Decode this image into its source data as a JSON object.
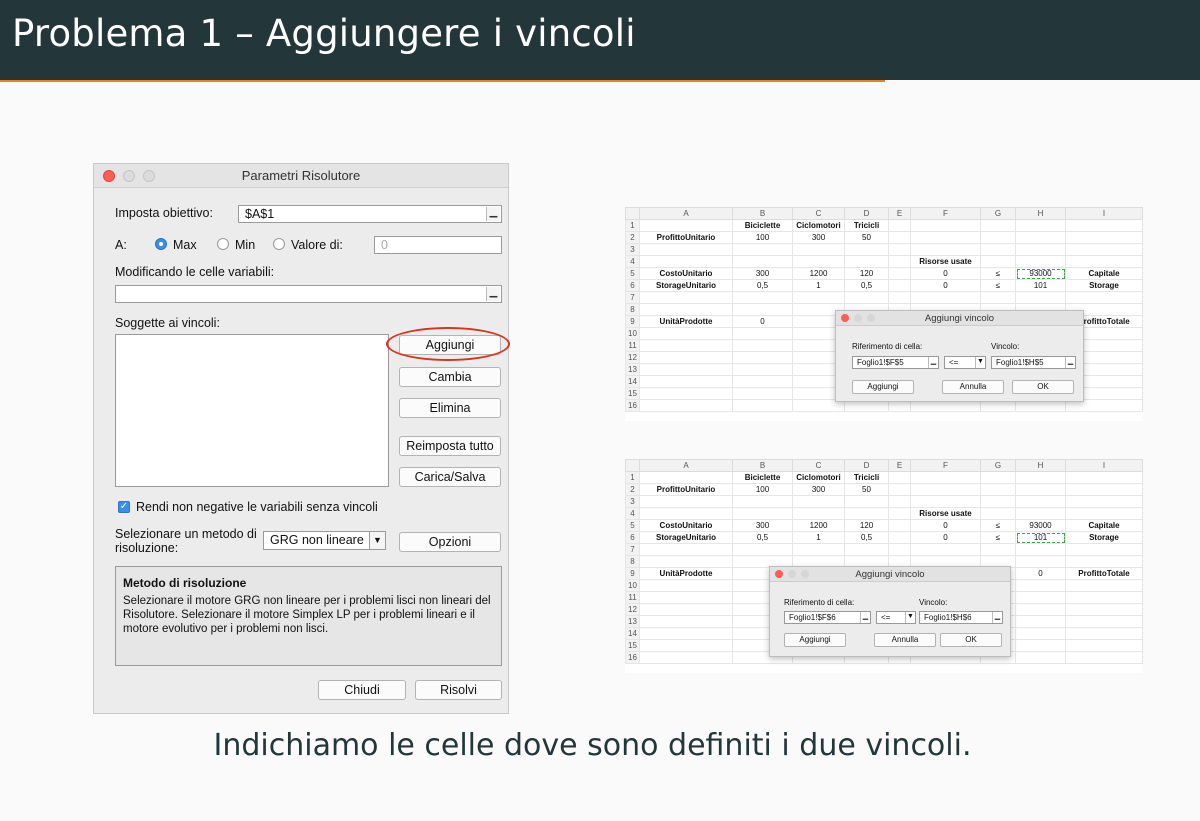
{
  "slide": {
    "title": "Problema 1 – Aggiungere i vincoli",
    "caption": "Indichiamo le celle dove sono definiti i due vincoli."
  },
  "solver": {
    "window_title": "Parametri Risolutore",
    "objective_label": "Imposta obiettivo:",
    "objective_value": "$A$1",
    "to_label": "A:",
    "opt_max": "Max",
    "opt_min": "Min",
    "opt_value": "Valore di:",
    "value_field": "0",
    "selected_option": "Max",
    "changing_label": "Modificando le celle variabili:",
    "changing_value": "",
    "constraints_label": "Soggette ai vincoli:",
    "buttons": {
      "add": "Aggiungi",
      "change": "Cambia",
      "delete": "Elimina",
      "reset": "Reimposta tutto",
      "load_save": "Carica/Salva",
      "options": "Opzioni",
      "close": "Chiudi",
      "solve": "Risolvi"
    },
    "nonneg_label": "Rendi non negative le variabili senza vincoli",
    "nonneg_checked": true,
    "method_label_1": "Selezionare un metodo di",
    "method_label_2": "risoluzione:",
    "method_value": "GRG non lineare",
    "method_box_title": "Metodo di risoluzione",
    "method_box_text": "Selezionare il motore GRG non lineare per i problemi lisci non lineari del Risolutore. Selezionare il motore Simplex LP per i problemi lineari e il motore evolutivo per i problemi non lisci."
  },
  "sheets": {
    "columns": [
      "",
      "A",
      "B",
      "C",
      "D",
      "E",
      "F",
      "G",
      "H",
      "I"
    ],
    "top": {
      "rows": [
        [
          "1",
          "",
          "Biciclette",
          "Ciclomotori",
          "Tricicli",
          "",
          "",
          "",
          "",
          ""
        ],
        [
          "2",
          "ProfittoUnitario",
          "100",
          "300",
          "50",
          "",
          "",
          "",
          "",
          ""
        ],
        [
          "3",
          "",
          "",
          "",
          "",
          "",
          "",
          "",
          "",
          ""
        ],
        [
          "4",
          "",
          "",
          "",
          "",
          "",
          "Risorse usate",
          "",
          "",
          ""
        ],
        [
          "5",
          "CostoUnitario",
          "300",
          "1200",
          "120",
          "",
          "0",
          "≤",
          "93000",
          "Capitale"
        ],
        [
          "6",
          "StorageUnitario",
          "0,5",
          "1",
          "0,5",
          "",
          "0",
          "≤",
          "101",
          "Storage"
        ],
        [
          "7",
          "",
          "",
          "",
          "",
          "",
          "",
          "",
          "",
          ""
        ],
        [
          "8",
          "",
          "",
          "",
          "",
          "",
          "",
          "",
          "",
          ""
        ],
        [
          "9",
          "UnitàProdotte",
          "0",
          "",
          "",
          "",
          "",
          "",
          "",
          "ProfittoTotale"
        ],
        [
          "10",
          "",
          "",
          "",
          "",
          "",
          "",
          "",
          "",
          ""
        ],
        [
          "11",
          "",
          "",
          "",
          "",
          "",
          "",
          "",
          "",
          ""
        ],
        [
          "12",
          "",
          "",
          "",
          "",
          "",
          "",
          "",
          "",
          ""
        ],
        [
          "13",
          "",
          "",
          "",
          "",
          "",
          "",
          "",
          "",
          ""
        ],
        [
          "14",
          "",
          "",
          "",
          "",
          "",
          "",
          "",
          "",
          ""
        ],
        [
          "15",
          "",
          "",
          "",
          "",
          "",
          "",
          "",
          "",
          ""
        ],
        [
          "16",
          "",
          "",
          "",
          "",
          "",
          "",
          "",
          "",
          ""
        ]
      ],
      "dialog": {
        "title": "Aggiungi vincolo",
        "ref_label": "Riferimento di cella:",
        "ref_value": "Foglio1!$F$5",
        "op": "<=",
        "constraint_label": "Vincolo:",
        "constraint_value": "Foglio1!$H$5",
        "add": "Aggiungi",
        "cancel": "Annulla",
        "ok": "OK"
      }
    },
    "bottom": {
      "rows": [
        [
          "1",
          "",
          "Biciclette",
          "Ciclomotori",
          "Tricicli",
          "",
          "",
          "",
          "",
          ""
        ],
        [
          "2",
          "ProfittoUnitario",
          "100",
          "300",
          "50",
          "",
          "",
          "",
          "",
          ""
        ],
        [
          "3",
          "",
          "",
          "",
          "",
          "",
          "",
          "",
          "",
          ""
        ],
        [
          "4",
          "",
          "",
          "",
          "",
          "",
          "Risorse usate",
          "",
          "",
          ""
        ],
        [
          "5",
          "CostoUnitario",
          "300",
          "1200",
          "120",
          "",
          "0",
          "≤",
          "93000",
          "Capitale"
        ],
        [
          "6",
          "StorageUnitario",
          "0,5",
          "1",
          "0,5",
          "",
          "0",
          "≤",
          "101",
          "Storage"
        ],
        [
          "7",
          "",
          "",
          "",
          "",
          "",
          "",
          "",
          "",
          ""
        ],
        [
          "8",
          "",
          "",
          "",
          "",
          "",
          "",
          "",
          "",
          ""
        ],
        [
          "9",
          "UnitàProdotte",
          "",
          "",
          "",
          "",
          "",
          "",
          "0",
          "ProfittoTotale"
        ],
        [
          "10",
          "",
          "",
          "",
          "",
          "",
          "",
          "",
          "",
          ""
        ],
        [
          "11",
          "",
          "",
          "",
          "",
          "",
          "",
          "",
          "",
          ""
        ],
        [
          "12",
          "",
          "",
          "",
          "",
          "",
          "",
          "",
          "",
          ""
        ],
        [
          "13",
          "",
          "",
          "",
          "",
          "",
          "",
          "",
          "",
          ""
        ],
        [
          "14",
          "",
          "",
          "",
          "",
          "",
          "",
          "",
          "",
          ""
        ],
        [
          "15",
          "",
          "",
          "",
          "",
          "",
          "",
          "",
          "",
          ""
        ],
        [
          "16",
          "",
          "",
          "",
          "",
          "",
          "",
          "",
          "",
          ""
        ]
      ],
      "dialog": {
        "title": "Aggiungi vincolo",
        "ref_label": "Riferimento di cella:",
        "ref_value": "Foglio1!$F$6",
        "op": "<=",
        "constraint_label": "Vincolo:",
        "constraint_value": "Foglio1!$H$6",
        "add": "Aggiungi",
        "cancel": "Annulla",
        "ok": "OK"
      }
    }
  },
  "colors": {
    "title_bg": "#23373b",
    "accent": "#eb811b",
    "highlight_ring": "#d9321f"
  }
}
